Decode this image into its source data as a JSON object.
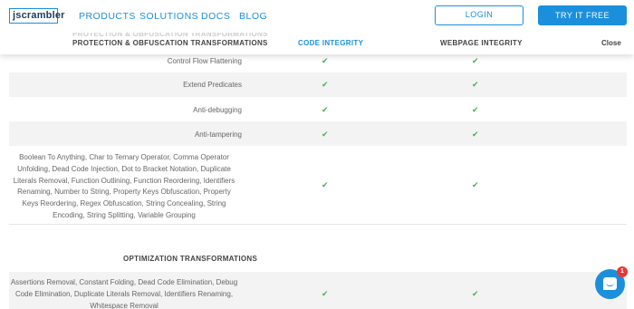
{
  "nav": {
    "logo": "jscrambler",
    "links": [
      "PRODUCTS",
      "SOLUTIONS",
      "DOCS",
      "BLOG"
    ],
    "login": "LOGIN",
    "try": "TRY IT FREE"
  },
  "compare_header": {
    "ghost": "PROTECTION & OBFUSCATION TRANSFORMATIONS",
    "col0": "PROTECTION & OBFUSCATION TRANSFORMATIONS",
    "col1": "CODE INTEGRITY",
    "col2": "WEBPAGE INTEGRITY",
    "close": "Close"
  },
  "rows": [
    {
      "label": "Control Flow Flattening",
      "c1": "✔",
      "c2": "✔"
    },
    {
      "label": "Extend Predicates",
      "c1": "✔",
      "c2": "✔"
    },
    {
      "label": "Anti-debugging",
      "c1": "✔",
      "c2": "✔"
    },
    {
      "label": "Anti-tampering",
      "c1": "✔",
      "c2": "✔"
    },
    {
      "label_lines": [
        "Boolean To Anything, Char to Ternary Operator, Comma Operator",
        "Unfolding, Dead Code Injection, Dot to Bracket Notation, Duplicate",
        "Literals Removal, Function Outlining, Function Reordering, Identifiers",
        "Renaming, Number to String, Property Keys Obfuscation, Property",
        "Keys Reordering, Regex Obfuscation, String Concealing, String",
        "Encoding, String Splitting, Variable Grouping"
      ],
      "c1": "✔",
      "c2": "✔"
    }
  ],
  "section2_title": "OPTIMIZATION TRANSFORMATIONS",
  "opt_row": {
    "label_lines": [
      "Assertions Removal, Constant Folding, Dead Code Elimination, Debug",
      "Code Elimination, Duplicate Literals Removal, Identifiers Renaming,",
      "Whitespace Removal"
    ],
    "c1": "✔",
    "c2": "✔"
  },
  "chat": {
    "badge": "1"
  },
  "colors": {
    "accent": "#1b8fdc",
    "check": "#4caf50",
    "badge": "#e53935"
  }
}
